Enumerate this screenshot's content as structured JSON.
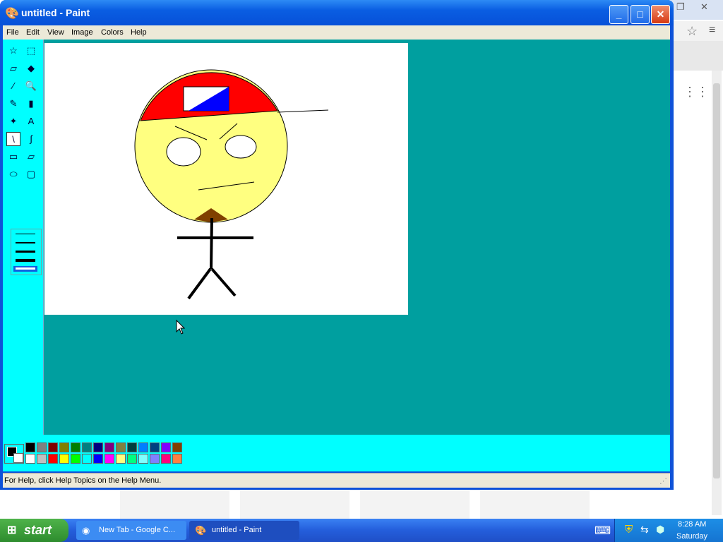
{
  "window": {
    "title": "untitled - Paint",
    "min": "_",
    "max": "□",
    "close": "✕"
  },
  "menu": [
    "File",
    "Edit",
    "View",
    "Image",
    "Colors",
    "Help"
  ],
  "tools": [
    "free-select",
    "rect-select",
    "eraser",
    "fill",
    "picker",
    "magnifier",
    "pencil",
    "brush",
    "airbrush",
    "text",
    "line",
    "curve",
    "rectangle",
    "polygon",
    "ellipse",
    "rounded-rect"
  ],
  "tool_glyphs": [
    "☆",
    "⬚",
    "▱",
    "◆",
    "⁄",
    "🔍",
    "✎",
    "▮",
    "✦",
    "A",
    "\\",
    "∫",
    "▭",
    "▱",
    "⬭",
    "▢"
  ],
  "selected_tool": "line",
  "palette_top": [
    "#000000",
    "#808080",
    "#800000",
    "#808000",
    "#008000",
    "#008080",
    "#000080",
    "#800080",
    "#808040",
    "#004040",
    "#0080ff",
    "#004080",
    "#8000ff",
    "#804000"
  ],
  "palette_bottom": [
    "#ffffff",
    "#c0c0c0",
    "#ff0000",
    "#ffff00",
    "#00ff00",
    "#00ffff",
    "#0000ff",
    "#ff00ff",
    "#ffff80",
    "#00ff80",
    "#80ffff",
    "#8080ff",
    "#ff0080",
    "#ff8040"
  ],
  "status": "For Help, click Help Topics on the Help Menu.",
  "taskbar": {
    "start": "start",
    "tasks": [
      {
        "label": "New Tab - Google C...",
        "icon": "chrome-icon"
      },
      {
        "label": "untitled - Paint",
        "icon": "paint-icon"
      }
    ],
    "time": "8:28 AM",
    "day": "Saturday"
  }
}
